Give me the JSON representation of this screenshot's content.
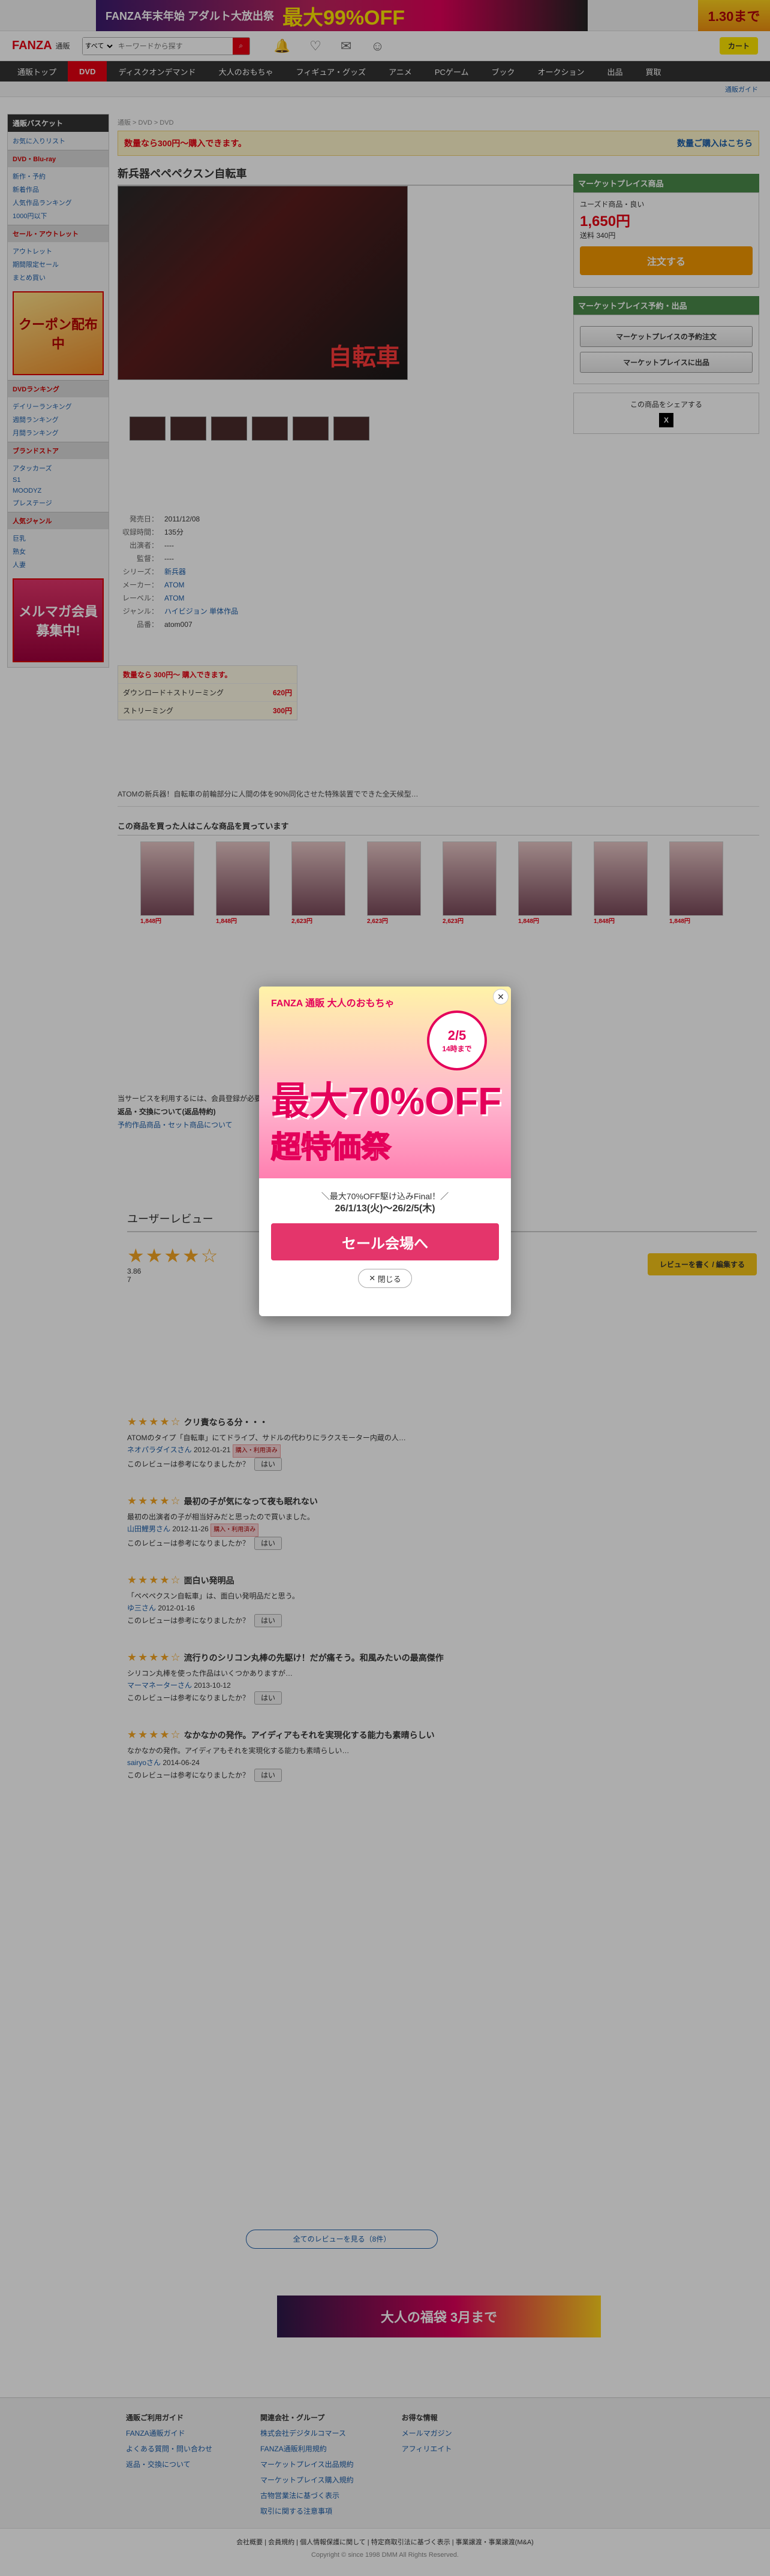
{
  "topbanner": {
    "text": "FANZA年末年始 アダルト大放出祭",
    "discount": "最大99%OFF",
    "right": "1.30まで"
  },
  "header": {
    "logo": "FANZA",
    "logo_sub": "通販",
    "search_scope": "すべて",
    "search_placeholder": "キーワードから探す",
    "cart": "カート"
  },
  "nav": [
    "通販トップ",
    "DVD",
    "ディスクオンデマンド",
    "大人のおもちゃ",
    "フィギュア・グッズ",
    "アニメ",
    "PCゲーム",
    "ブック",
    "オークション",
    "出品",
    "買取"
  ],
  "subbar": "通販ガイド",
  "sidebar": {
    "head": "通販バスケット",
    "link": "お気に入りリスト",
    "sec1": "DVD・Blu-ray",
    "items1": [
      "新作・予約",
      "新着作品",
      "人気作品ランキング",
      "1000円以下"
    ],
    "sec2": "セール・アウトレット",
    "items2": [
      "アウトレット",
      "期間限定セール",
      "まとめ買い"
    ],
    "promo": "クーポン配布中",
    "sec3": "DVDランキング",
    "items3": [
      "デイリーランキング",
      "週間ランキング",
      "月間ランキング"
    ],
    "sec4": "ブランドストア",
    "items4": [
      "アタッカーズ",
      "S1",
      "MOODYZ",
      "プレステージ"
    ],
    "sec5": "人気ジャンル",
    "items5": [
      "巨乳",
      "熟女",
      "人妻"
    ],
    "sec6": "メルマガ会員募集中!"
  },
  "breadcrumb": "通販 > DVD > DVD",
  "notice": {
    "text": "数量なら300円〜購入できます。",
    "link": "数量ご購入はこちら"
  },
  "title": "新兵器ペペペクスン自転車",
  "package_text": "自転車",
  "specs": [
    {
      "k": "発売日：",
      "v": "2011/12/08"
    },
    {
      "k": "収録時間：",
      "v": "135分"
    },
    {
      "k": "出演者：",
      "v": "----"
    },
    {
      "k": "監督：",
      "v": "----"
    },
    {
      "k": "シリーズ：",
      "v": "新兵器"
    },
    {
      "k": "メーカー：",
      "v": "ATOM"
    },
    {
      "k": "レーベル：",
      "v": "ATOM"
    },
    {
      "k": "ジャンル：",
      "v": "ハイビジョン 単体作品"
    },
    {
      "k": "品番：",
      "v": "atom007"
    }
  ],
  "pricebox": {
    "head": "数量なら 300円〜 購入できます。",
    "rows": [
      {
        "k": "ダウンロード＋ストリーミング",
        "v": "620円"
      },
      {
        "k": "ストリーミング",
        "v": "300円"
      }
    ]
  },
  "right": {
    "head1": "マーケットプレイス商品",
    "seller": "ユーズド商品・良い",
    "price": "1,650円",
    "shipping": "送料 340円",
    "buy": "注文する",
    "head2": "マーケットプレイス予約・出品",
    "btn1": "マーケットプレイスの予約注文",
    "btn2": "マーケットプレイスに出品",
    "share": "この商品をシェアする"
  },
  "description": "ATOMの新兵器！自転車の前輪部分に人間の体を90%同化させた特殊装置でできた全天候型…",
  "also_title": "この商品を買った人はこんな商品を買っています",
  "also": [
    {
      "p": "1,848円"
    },
    {
      "p": "1,848円"
    },
    {
      "p": "2,623円"
    },
    {
      "p": "2,623円"
    },
    {
      "p": "2,623円"
    },
    {
      "p": "1,848円"
    },
    {
      "p": "1,848円"
    },
    {
      "p": "1,848円"
    }
  ],
  "info": {
    "l1": "当サービスを利用するには、会員登録が必要です。",
    "l2": "返品・交換について(返品特約)",
    "l3": "予約作品商品・セット商品について"
  },
  "review": {
    "title": "ユーザーレビュー",
    "avg": "3.86",
    "count": "7",
    "btn": "レビューを書く / 編集する",
    "items": [
      {
        "t": "クリ責ならる分・・・",
        "body": "ATOMのタイプ「自転車」にてドライブ、サドルの代わりにラクスモーター内蔵の人…",
        "user": "ネオパラダイスさん",
        "date": "2012-01-21"
      },
      {
        "t": "最初の子が気になって夜も眠れない",
        "body": "最初の出演者の子が相当好みだと思ったので買いました。",
        "user": "山田鯉男さん",
        "date": "2012-11-26"
      },
      {
        "t": "面白い発明品",
        "body": "「ペペペクスン自転車」は、面白い発明品だと思う。",
        "user": "ゆ三さん",
        "date": "2012-01-16"
      },
      {
        "t": "流行りのシリコン丸棒の先駆け！だが痛そう。和風みたいの最高傑作",
        "body": "シリコン丸棒を使った作品はいくつかありますが…",
        "user": "マーマネーターさん",
        "date": "2013-10-12"
      },
      {
        "t": "なかなかの発作。アイディアもそれを実現化する能力も素晴らしい",
        "body": "なかなかの発作。アイディアもそれを実現化する能力も素晴らしい…",
        "user": "sairyoさん",
        "date": "2014-06-24"
      }
    ],
    "all": "全てのレビューを見る（8件）"
  },
  "modal": {
    "logo": "FANZA 通販 大人のおもちゃ",
    "date": "2/5",
    "date2": "14時まで",
    "off": "最大70%OFF",
    "fest": "超特価祭",
    "sub1": "＼最大70%OFF駆け込みFinal！／",
    "sub2": "26/1/13(火)〜26/2/5(木)",
    "cta": "セール会場へ",
    "close": "閉じる"
  },
  "bottom_banner": "大人の福袋 3月まで",
  "footer": {
    "cols": [
      {
        "h": "通販ご利用ガイド",
        "items": [
          "FANZA通販ガイド",
          "よくある質問・問い合わせ",
          "返品・交換について"
        ]
      },
      {
        "h": "関連会社・グループ",
        "items": [
          "株式会社デジタルコマース",
          "FANZA通販利用規約",
          "マーケットプレイス出品規約",
          "マーケットプレイス購入規約",
          "古物営業法に基づく表示",
          "取引に関する注意事項"
        ]
      },
      {
        "h": "お得な情報",
        "items": [
          "メールマガジン",
          "アフィリエイト"
        ]
      }
    ],
    "links": "会社概要 | 会員規約 | 個人情報保護に関して | 特定商取引法に基づく表示 | 事業譲渡・事業譲渡(M&A)",
    "copy": "Copyright © since 1998 DMM All Rights Reserved."
  }
}
